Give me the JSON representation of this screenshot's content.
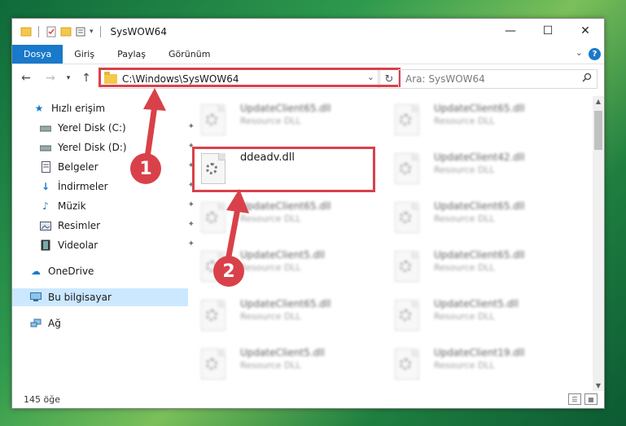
{
  "window": {
    "title": "SysWOW64",
    "controls": {
      "minimize": "—",
      "maximize": "☐",
      "close": "✕"
    }
  },
  "ribbon": {
    "tabs": [
      "Dosya",
      "Giriş",
      "Paylaş",
      "Görünüm"
    ],
    "active_tab": "Dosya",
    "help": "?"
  },
  "nav": {
    "address": "C:\\Windows\\SysWOW64",
    "search_placeholder": "Ara: SysWOW64"
  },
  "sidebar": {
    "items": [
      {
        "label": "Hızlı erişim",
        "icon": "star-icon"
      },
      {
        "label": "Yerel Disk (C:)",
        "icon": "drive-icon",
        "pinned": true
      },
      {
        "label": "Yerel Disk (D:)",
        "icon": "drive-icon",
        "pinned": true
      },
      {
        "label": "Belgeler",
        "icon": "document-icon",
        "pinned": true
      },
      {
        "label": "İndirmeler",
        "icon": "download-icon",
        "pinned": true
      },
      {
        "label": "Müzik",
        "icon": "music-icon",
        "pinned": true
      },
      {
        "label": "Resimler",
        "icon": "pictures-icon",
        "pinned": true
      },
      {
        "label": "Videolar",
        "icon": "video-icon",
        "pinned": true
      },
      {
        "label": "OneDrive",
        "icon": "cloud-icon"
      },
      {
        "label": "Bu bilgisayar",
        "icon": "computer-icon",
        "selected": true
      },
      {
        "label": "Ağ",
        "icon": "network-icon"
      }
    ]
  },
  "files": {
    "left": [
      {
        "name": "UpdateClient65.dll",
        "type": "Resource DLL",
        "blurred": true
      },
      {
        "name": "ddeadv.dll",
        "type": "",
        "blurred": false,
        "highlighted": true
      },
      {
        "name": "UpdateClient65.dll",
        "type": "Resource DLL",
        "blurred": true
      },
      {
        "name": "UpdateClient5.dll",
        "type": "Resource DLL",
        "blurred": true
      },
      {
        "name": "UpdateClient65.dll",
        "type": "Resource DLL",
        "blurred": true
      },
      {
        "name": "UpdateClient5.dll",
        "type": "Resource DLL",
        "blurred": true
      }
    ],
    "right": [
      {
        "name": "UpdateClient65.dll",
        "type": "Resource DLL",
        "blurred": true
      },
      {
        "name": "UpdateClient42.dll",
        "type": "Resource DLL",
        "blurred": true
      },
      {
        "name": "UpdateClient65.dll",
        "type": "Resource DLL",
        "blurred": true
      },
      {
        "name": "UpdateClient65.dll",
        "type": "Resource DLL",
        "blurred": true
      },
      {
        "name": "UpdateClient5.dll",
        "type": "Resource DLL",
        "blurred": true
      },
      {
        "name": "UpdateClient19.dll",
        "type": "Resource DLL",
        "blurred": true
      }
    ]
  },
  "status": {
    "count": "145 öğe"
  },
  "annotations": {
    "step1": "1",
    "step2": "2",
    "accent": "#d9414a"
  }
}
